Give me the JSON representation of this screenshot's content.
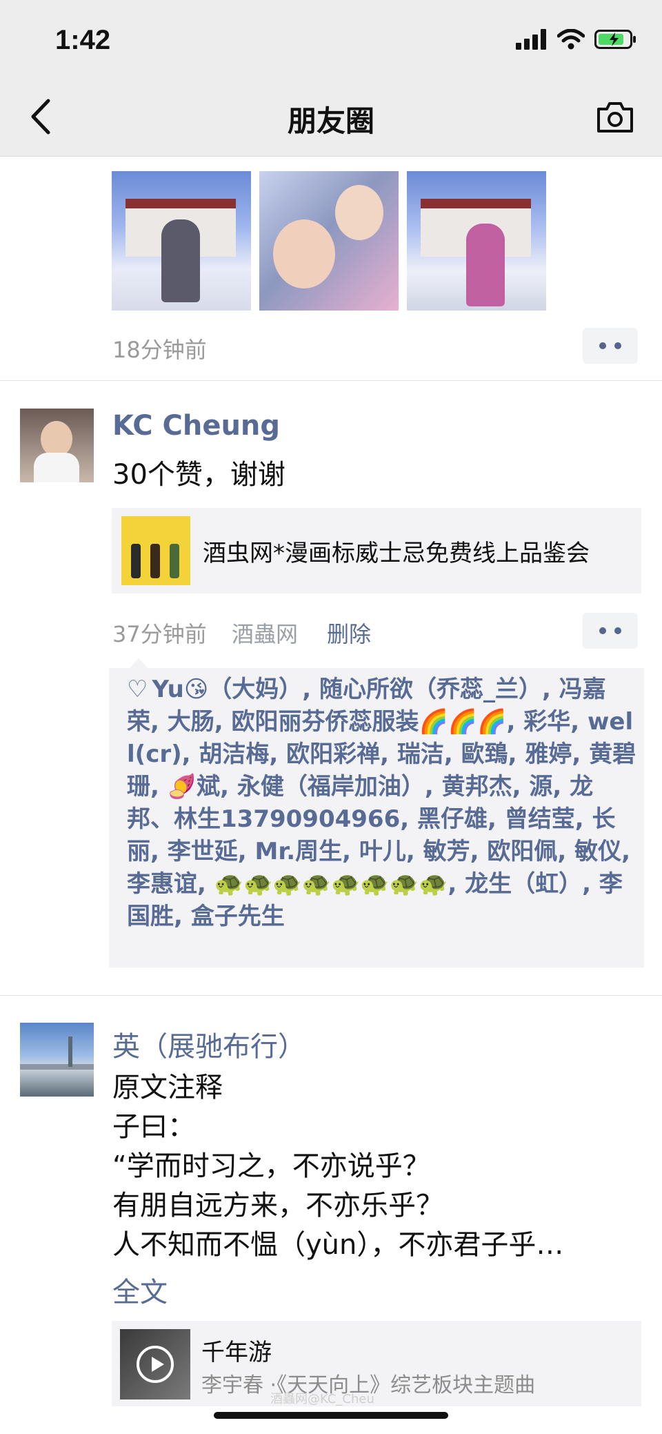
{
  "status_bar": {
    "time": "1:42"
  },
  "navbar": {
    "title": "朋友圈"
  },
  "post1": {
    "time": "18分钟前"
  },
  "post2": {
    "username": "KC Cheung",
    "text": "30个赞，谢谢",
    "link_title": "酒虫网*漫画标威士忌免费线上品鉴会",
    "time": "37分钟前",
    "source": "酒蟲网",
    "delete_label": "删除",
    "likes": "Yu😘（大妈）, 随心所欲（乔蕊_兰）, 冯嘉荣, 大肠, 欧阳丽芬侨蕊服装🌈🌈🌈, 彩华, well(cr), 胡洁梅, 欧阳彩禅, 瑞洁, 歐鵄, 雅婷, 黄碧珊, 🍠斌, 永健（福岸加油）, 黄邦杰, 源, 龙邦、林生13790904966, 黑仔雄, 曾结莹, 长丽, 李世延, Mr.周生, 叶儿, 敏芳, 欧阳佩, 敏仪, 李惠谊, 🐢🐢🐢🐢🐢🐢🐢🐢, 龙生（虹）, 李国胜, 盒子先生"
  },
  "post3": {
    "username": "英（展驰布行）",
    "lines": [
      "原文注释",
      "子曰：",
      "“学而时习之，不亦说乎？",
      "有朋自远方来，不亦乐乎？",
      "人不知而不愠（yùn），不亦君子乎…"
    ],
    "full_text_label": "全文",
    "music_title": "千年游",
    "music_subtitle": "李宇春 ·《天天向上》综艺板块主题曲"
  },
  "watermark": "酒蟲网@KC_Cheu"
}
